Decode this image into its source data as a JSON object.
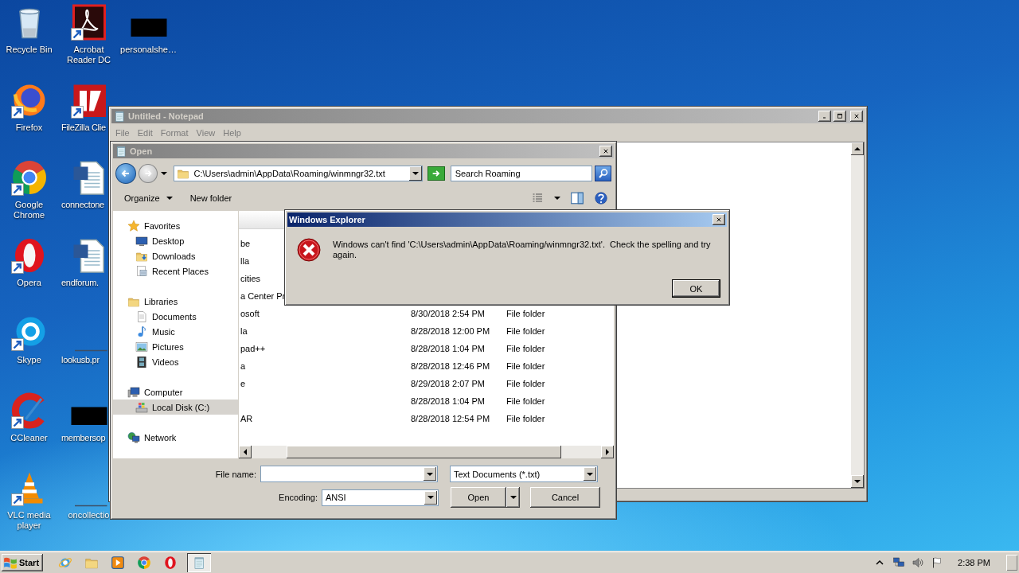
{
  "desktop": {
    "icons": [
      {
        "kind": "recycle-bin",
        "label": "Recycle Bin",
        "shortcut": false
      },
      {
        "kind": "firefox",
        "label": "Firefox",
        "shortcut": true
      },
      {
        "kind": "chrome",
        "label": "Google Chrome",
        "shortcut": true
      },
      {
        "kind": "opera",
        "label": "Opera",
        "shortcut": true
      },
      {
        "kind": "skype",
        "label": "Skype",
        "shortcut": true
      },
      {
        "kind": "ccleaner",
        "label": "CCleaner",
        "shortcut": true
      },
      {
        "kind": "vlc",
        "label": "VLC media player",
        "shortcut": true
      },
      {
        "kind": "acrobat",
        "label": "Acrobat Reader DC",
        "shortcut": true
      },
      {
        "kind": "filezilla",
        "label": "FileZilla Clie",
        "shortcut": true
      },
      {
        "kind": "word",
        "label": "connectone",
        "shortcut": false
      },
      {
        "kind": "word",
        "label": "endforum.",
        "shortcut": false
      },
      {
        "kind": "blank",
        "label": "lookusb.pr",
        "shortcut": false
      },
      {
        "kind": "redacted",
        "label": "membersop",
        "shortcut": false
      },
      {
        "kind": "blank",
        "label": "oncollectio",
        "shortcut": false
      },
      {
        "kind": "redacted",
        "label": "personalshe…",
        "shortcut": false
      }
    ]
  },
  "notepad": {
    "title": "Untitled - Notepad",
    "active": false,
    "menu": [
      "File",
      "Edit",
      "Format",
      "View",
      "Help"
    ]
  },
  "open_dialog": {
    "title": "Open",
    "active": false,
    "address": "C:\\Users\\admin\\AppData\\Roaming/winmngr32.txt",
    "search": {
      "placeholder": "Search Roaming"
    },
    "toolbar": [
      {
        "label": "Organize",
        "has_menu": true
      },
      {
        "label": "New folder",
        "has_menu": false
      }
    ],
    "nav_tree": [
      {
        "kind": "favorites",
        "label": "Favorites",
        "selected": false,
        "children": [
          {
            "kind": "desktop",
            "label": "Desktop",
            "selected": false
          },
          {
            "kind": "downloads",
            "label": "Downloads",
            "selected": false
          },
          {
            "kind": "recent",
            "label": "Recent Places",
            "selected": false
          }
        ]
      },
      {
        "kind": "libraries",
        "label": "Libraries",
        "selected": false,
        "children": [
          {
            "kind": "documents",
            "label": "Documents",
            "selected": false
          },
          {
            "kind": "music",
            "label": "Music",
            "selected": false
          },
          {
            "kind": "pictures",
            "label": "Pictures",
            "selected": false
          },
          {
            "kind": "videos",
            "label": "Videos",
            "selected": false
          }
        ]
      },
      {
        "kind": "computer",
        "label": "Computer",
        "selected": false,
        "children": [
          {
            "kind": "disk",
            "label": "Local Disk (C:)",
            "selected": true
          }
        ]
      },
      {
        "kind": "network",
        "label": "Network",
        "selected": false
      }
    ],
    "files": [
      {
        "name": "be"
      },
      {
        "name": "lla"
      },
      {
        "name": "cities"
      },
      {
        "name": "a Center Pr"
      },
      {
        "name": "osoft",
        "date": "8/30/2018 2:54 PM",
        "type": "File folder"
      },
      {
        "name": "la",
        "date": "8/28/2018 12:00 PM",
        "type": "File folder"
      },
      {
        "name": "pad++",
        "date": "8/28/2018 1:04 PM",
        "type": "File folder"
      },
      {
        "name": "a",
        "date": "8/28/2018 12:46 PM",
        "type": "File folder"
      },
      {
        "name": "e",
        "date": "8/29/2018 2:07 PM",
        "type": "File folder"
      },
      {
        "date": "8/28/2018 1:04 PM",
        "type": "File folder"
      },
      {
        "name": "AR",
        "date": "8/28/2018 12:54 PM",
        "type": "File folder"
      }
    ],
    "file_name": {
      "label": "File name:"
    },
    "file_type": "Text Documents (*.txt)",
    "encoding": {
      "label": "Encoding:",
      "value": "ANSI"
    },
    "buttons": [
      {
        "label": "Open",
        "split": true
      },
      {
        "label": "Cancel",
        "split": false
      }
    ]
  },
  "error_dialog": {
    "title": "Windows Explorer",
    "active": true,
    "message": "Windows can't find 'C:\\Users\\admin\\AppData\\Roaming/winmngr32.txt'.  Check the spelling and try again.",
    "buttons": [
      {
        "label": "OK",
        "default": true
      }
    ]
  },
  "taskbar": {
    "start": "Start",
    "apps": [
      {
        "kind": "ie",
        "active": false
      },
      {
        "kind": "explorer",
        "active": false
      },
      {
        "kind": "media",
        "active": false
      },
      {
        "kind": "chrome",
        "active": false
      },
      {
        "kind": "opera",
        "active": false
      },
      {
        "kind": "notepad",
        "active": true
      }
    ],
    "tray": [
      {
        "kind": "chevron"
      },
      {
        "kind": "network"
      },
      {
        "kind": "speaker"
      },
      {
        "kind": "flag"
      }
    ],
    "clock": "2:38 PM"
  }
}
